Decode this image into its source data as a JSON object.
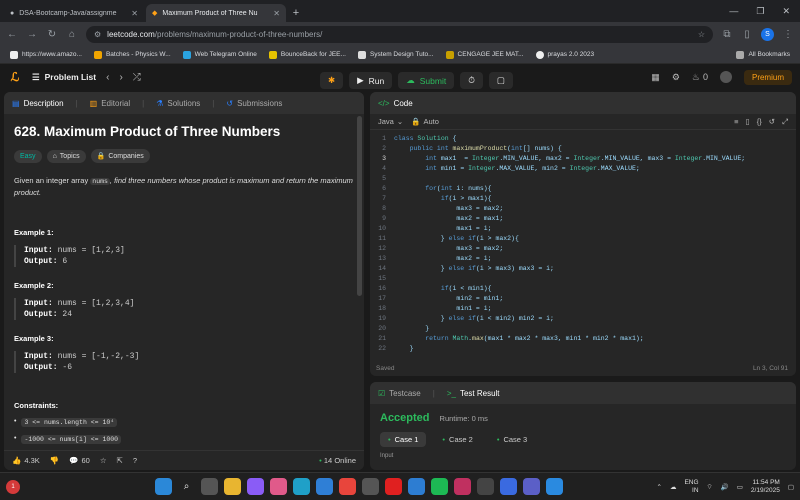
{
  "browser": {
    "tabs": [
      {
        "title": "DSA-Bootcamp-Java/assignme",
        "active": false
      },
      {
        "title": "Maximum Product of Three Nu",
        "active": true
      }
    ],
    "url_host": "leetcode.com",
    "url_path": "/problems/maximum-product-of-three-numbers/",
    "profile_letter": "S",
    "bookmarks": [
      "https://www.amazo...",
      "Batches - Physics W...",
      "Web Telegram Online",
      "BounceBack for JEE...",
      "System Design Tuto...",
      "CENGAGE JEE MAT...",
      "prayas 2.0 2023"
    ],
    "all_bookmarks": "All Bookmarks"
  },
  "lc": {
    "problem_list": "Problem List",
    "run": "Run",
    "submit": "Submit",
    "streak": "0",
    "premium": "Premium"
  },
  "left": {
    "tabs": [
      "Description",
      "Editorial",
      "Solutions",
      "Submissions"
    ],
    "title": "628. Maximum Product of Three Numbers",
    "chips": [
      "Easy",
      "Topics",
      "Companies"
    ],
    "desc_pre": "Given an integer array ",
    "desc_code": "nums",
    "desc_post": ", find three numbers whose product is maximum and return the maximum product.",
    "examples": [
      {
        "h": "Example 1:",
        "input": "nums = [1,2,3]",
        "output": "6"
      },
      {
        "h": "Example 2:",
        "input": "nums = [1,2,3,4]",
        "output": "24"
      },
      {
        "h": "Example 3:",
        "input": "nums = [-1,-2,-3]",
        "output": "-6"
      }
    ],
    "input_label": "Input:",
    "output_label": "Output:",
    "constraints_h": "Constraints:",
    "constraints": [
      "3 <= nums.length <= 10⁴",
      "-1000 <= nums[i] <= 1000"
    ],
    "likes": "4.3K",
    "comments": "60",
    "online": "14 Online"
  },
  "code": {
    "title": "Code",
    "lang": "Java",
    "auto": "Auto",
    "lines": [
      "class Solution {",
      "    public int maximumProduct(int[] nums) {",
      "        int max1  = Integer.MIN_VALUE, max2 = Integer.MIN_VALUE, max3 = Integer.MIN_VALUE;",
      "        int min1 = Integer.MAX_VALUE, min2 = Integer.MAX_VALUE;",
      "",
      "        for(int i: nums){",
      "            if(i > max1){",
      "                max3 = max2;",
      "                max2 = max1;",
      "                max1 = i;",
      "            } else if(i > max2){",
      "                max3 = max2;",
      "                max2 = i;",
      "            } else if(i > max3) max3 = i;",
      "",
      "            if(i < min1){",
      "                min2 = min1;",
      "                min1 = i;",
      "            } else if(i < min2) min2 = i;",
      "        }",
      "        return Math.max(max1 * max2 * max3, min1 * min2 * max1);",
      "    }"
    ],
    "saved": "Saved",
    "position": "Ln 3, Col 91"
  },
  "test": {
    "tabs": [
      "Testcase",
      "Test Result"
    ],
    "status": "Accepted",
    "runtime": "Runtime: 0 ms",
    "cases": [
      "Case 1",
      "Case 2",
      "Case 3"
    ],
    "input_label": "Input"
  },
  "taskbar": {
    "lang": "ENG",
    "region": "IN",
    "time": "11:54 PM",
    "date": "2/19/2025",
    "weather_badge": "1"
  }
}
